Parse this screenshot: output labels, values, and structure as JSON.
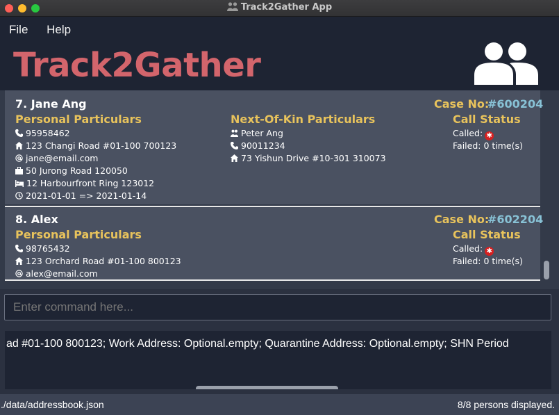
{
  "window": {
    "title": "Track2Gather App"
  },
  "menu": {
    "file": "File",
    "help": "Help"
  },
  "app_title": "Track2Gather",
  "persons": [
    {
      "name": "7.  Jane Ang",
      "case_label": "Case No:",
      "case_no": "#600204",
      "personal_header": "Personal Particulars",
      "phone": "95958462",
      "home": "123 Changi Road #01-100 700123",
      "email": "jane@email.com",
      "work": "50 Jurong Road 120050",
      "quarantine": "12 Harbourfront Ring 123012",
      "shn": "2021-01-01 => 2021-01-14",
      "nok_header": "Next-Of-Kin Particulars",
      "nok_name": "Peter Ang",
      "nok_phone": "90011234",
      "nok_address": "73 Yishun Drive #10-301 310073",
      "call_header": "Call Status",
      "called": "Called:",
      "failed": "Failed: 0 time(s)"
    },
    {
      "name": "8.  Alex",
      "case_label": "Case No:",
      "case_no": "#602204",
      "personal_header": "Personal Particulars",
      "phone": "98765432",
      "home": "123 Orchard Road #01-100 800123",
      "email": "alex@email.com",
      "call_header": "Call Status",
      "called": "Called:",
      "failed": "Failed: 0 time(s)"
    }
  ],
  "command": {
    "placeholder": "Enter command here..."
  },
  "result": {
    "text": "ad #01-100 800123; Work Address: Optional.empty; Quarantine Address: Optional.empty; SHN Period"
  },
  "statusbar": {
    "path": "./data/addressbook.json",
    "count": "8/8 persons displayed."
  },
  "colors": {
    "accent": "#d3656c",
    "section": "#e8c35c",
    "case_no": "#88c2d6",
    "error": "#d62020"
  },
  "icons": [
    "people-icon",
    "phone-icon",
    "home-icon",
    "email-icon",
    "work-icon",
    "bed-icon",
    "clock-icon",
    "person-icon",
    "cross-icon"
  ]
}
